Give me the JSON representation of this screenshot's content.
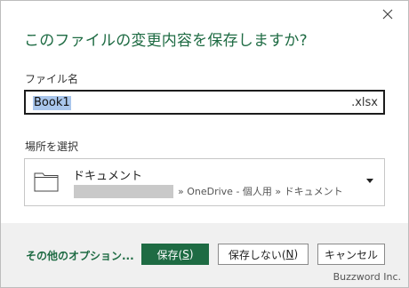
{
  "dialog": {
    "title": "このファイルの変更内容を保存しますか?",
    "close_icon": "close-icon"
  },
  "filename": {
    "label": "ファイル名",
    "value": "Book1",
    "extension": ".xlsx"
  },
  "location": {
    "label": "場所を選択",
    "folder_icon": "folder-icon",
    "name": "ドキュメント",
    "path": "» OneDrive - 個人用 » ドキュメント",
    "dropdown_icon": "caret-down-icon"
  },
  "footer": {
    "more_options": "その他のオプション...",
    "save_label": "保存(",
    "save_key": "S",
    "save_end": ")",
    "dont_save_label": "保存しない(",
    "dont_save_key": "N",
    "dont_save_end": ")",
    "cancel_label": "キャンセル",
    "watermark": "Buzzword Inc."
  },
  "colors": {
    "accent": "#1e6b43",
    "selection": "#a9c6ec",
    "footer_bg": "#f0f0f0"
  }
}
